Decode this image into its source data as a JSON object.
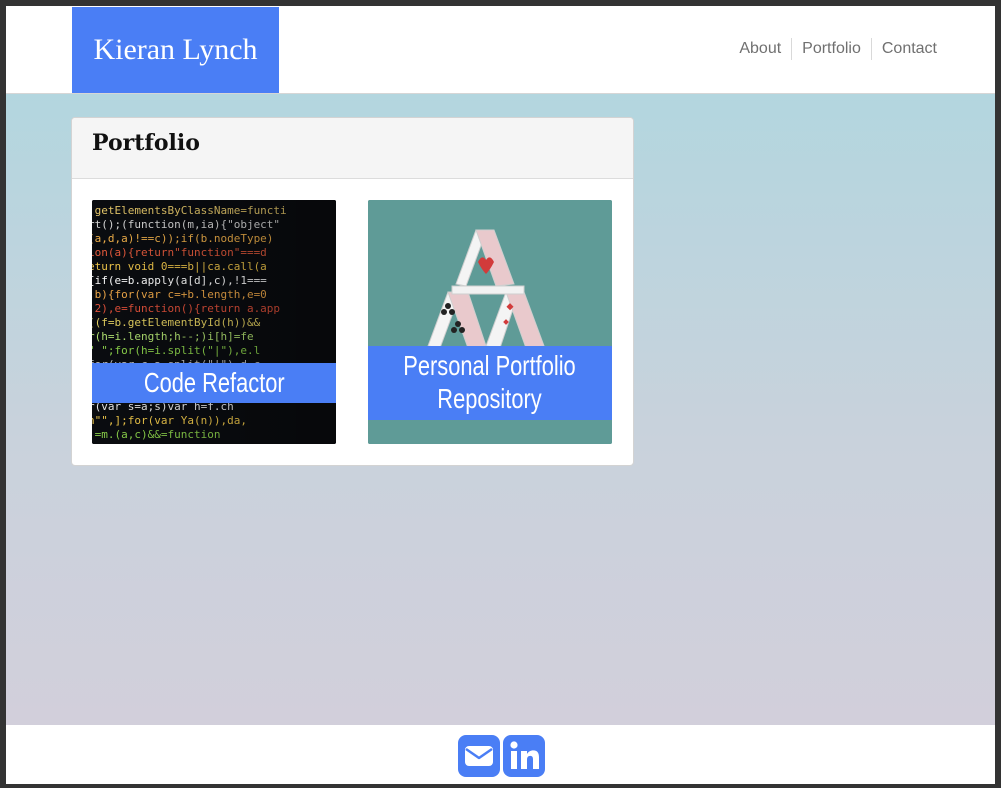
{
  "header": {
    "brand": "Kieran Lynch",
    "nav": [
      "About",
      "Portfolio",
      "Contact"
    ]
  },
  "portfolio": {
    "title": "Portfolio",
    "projects": [
      {
        "label": "Code Refactor",
        "image_icon": "code-screen-image"
      },
      {
        "label_lines": [
          "Personal Portfolio",
          "Repository"
        ],
        "image_icon": "house-of-cards-image"
      }
    ]
  },
  "footer": {
    "icons": [
      "envelope-icon",
      "linkedin-icon"
    ]
  },
  "colors": {
    "accent": "#4a7ef5",
    "card_tile_bg": "#5f9b97",
    "page_gradient_top": "#b3d6df",
    "page_gradient_bottom": "#d2cfdb"
  }
}
